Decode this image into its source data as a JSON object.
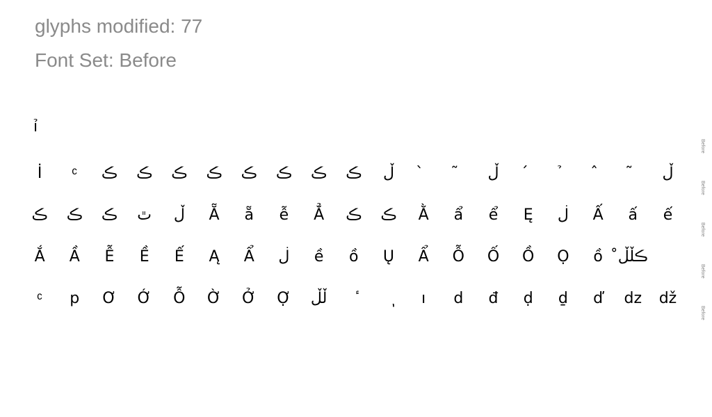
{
  "header": {
    "glyphs_modified": "glyphs modified: 77",
    "font_set": "Font Set: Before"
  },
  "lone_glyph": "ỉ",
  "row_label": "Before",
  "rows": [
    [
      "İ",
      "ͨ",
      "ڪ",
      "ڪ",
      "ڪ",
      "ڪ",
      "ڪ",
      "ڪ",
      "ڪ",
      "ڪ",
      "ڵ",
      "̀",
      "̃",
      "ڵ",
      "́",
      "̉",
      "̂",
      "̃",
      "ڵ"
    ],
    [
      "ڪ",
      "ڪ",
      "ڪ",
      "ٿ",
      "ڵ",
      "Ẵ",
      "ẵ",
      "ễ",
      "Ẳ",
      "ڪ",
      "ڪ",
      "Ằ",
      "ẩ",
      "ể",
      "Ę",
      "ڶ",
      "Ấ",
      "ấ",
      "ế"
    ],
    [
      "Ắ",
      "Ầ",
      "Ễ",
      "Ề",
      "Ế",
      "Ą",
      "Ẩ",
      "ڶ",
      "ề",
      "ồ",
      "Ų",
      "Ẩ",
      "Ỗ",
      "Ố",
      "Ồ",
      "Ọ",
      "ồ",
      "ڪڵڵ̊"
    ],
    [
      "ͨ",
      "p",
      "Ơ",
      "Ớ",
      "Ỗ",
      "Ờ",
      "Ở",
      "Ợ",
      "ڵڵ",
      "ٔ",
      "ٖ",
      "ו",
      "d",
      "đ",
      "ḍ",
      "ḏ",
      "ď",
      "dz",
      "dž"
    ]
  ]
}
